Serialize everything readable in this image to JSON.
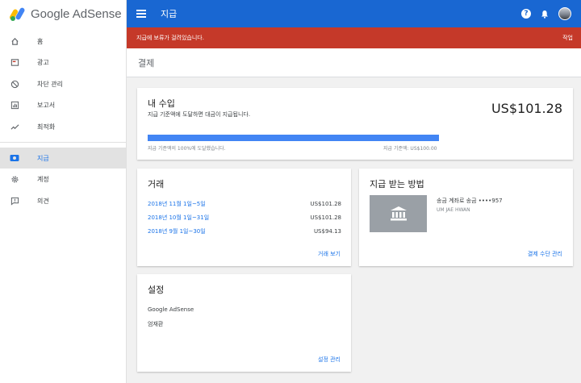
{
  "app": {
    "name": "Google AdSense"
  },
  "sidebar": {
    "items": [
      {
        "label": "홈",
        "icon": "home-icon"
      },
      {
        "label": "광고",
        "icon": "ads-icon"
      },
      {
        "label": "차단 관리",
        "icon": "block-icon"
      },
      {
        "label": "보고서",
        "icon": "reports-icon"
      },
      {
        "label": "최적화",
        "icon": "optimization-icon"
      },
      {
        "label": "지급",
        "icon": "payments-icon",
        "active": true
      },
      {
        "label": "계정",
        "icon": "gear-icon"
      },
      {
        "label": "의견",
        "icon": "feedback-icon"
      }
    ]
  },
  "topbar": {
    "title": "지급"
  },
  "alert": {
    "message": "지급에 보류가 걸려있습니다.",
    "action": "작업"
  },
  "page": {
    "title": "결제"
  },
  "earnings": {
    "title": "내 수입",
    "description": "지급 기준액에 도달하면 대금이 지급됩니다.",
    "amount": "US$101.28",
    "progress_percent": 100,
    "progress_message": "지급 기준액의 100%에 도달했습니다.",
    "threshold": "지급 기준액: US$100.00"
  },
  "transactions": {
    "title": "거래",
    "rows": [
      {
        "period": "2018년 11월 1일~5일",
        "amount": "US$101.28"
      },
      {
        "period": "2018년 10월 1일~31일",
        "amount": "US$101.28"
      },
      {
        "period": "2018년 9월 1일~30일",
        "amount": "US$94.13"
      }
    ],
    "link": "거래 보기"
  },
  "payment_method": {
    "title": "지급 받는 방법",
    "account": "송금 계좌로 송금 ••••957",
    "holder": "UM JAE HWAN",
    "link": "결제 수단 관리"
  },
  "settings": {
    "title": "설정",
    "product": "Google AdSense",
    "name": "엄재환",
    "link": "설정 관리"
  },
  "colors": {
    "primary": "#1967d2",
    "alert": "#c53929",
    "link": "#1a73e8",
    "progress": "#4285f4"
  }
}
